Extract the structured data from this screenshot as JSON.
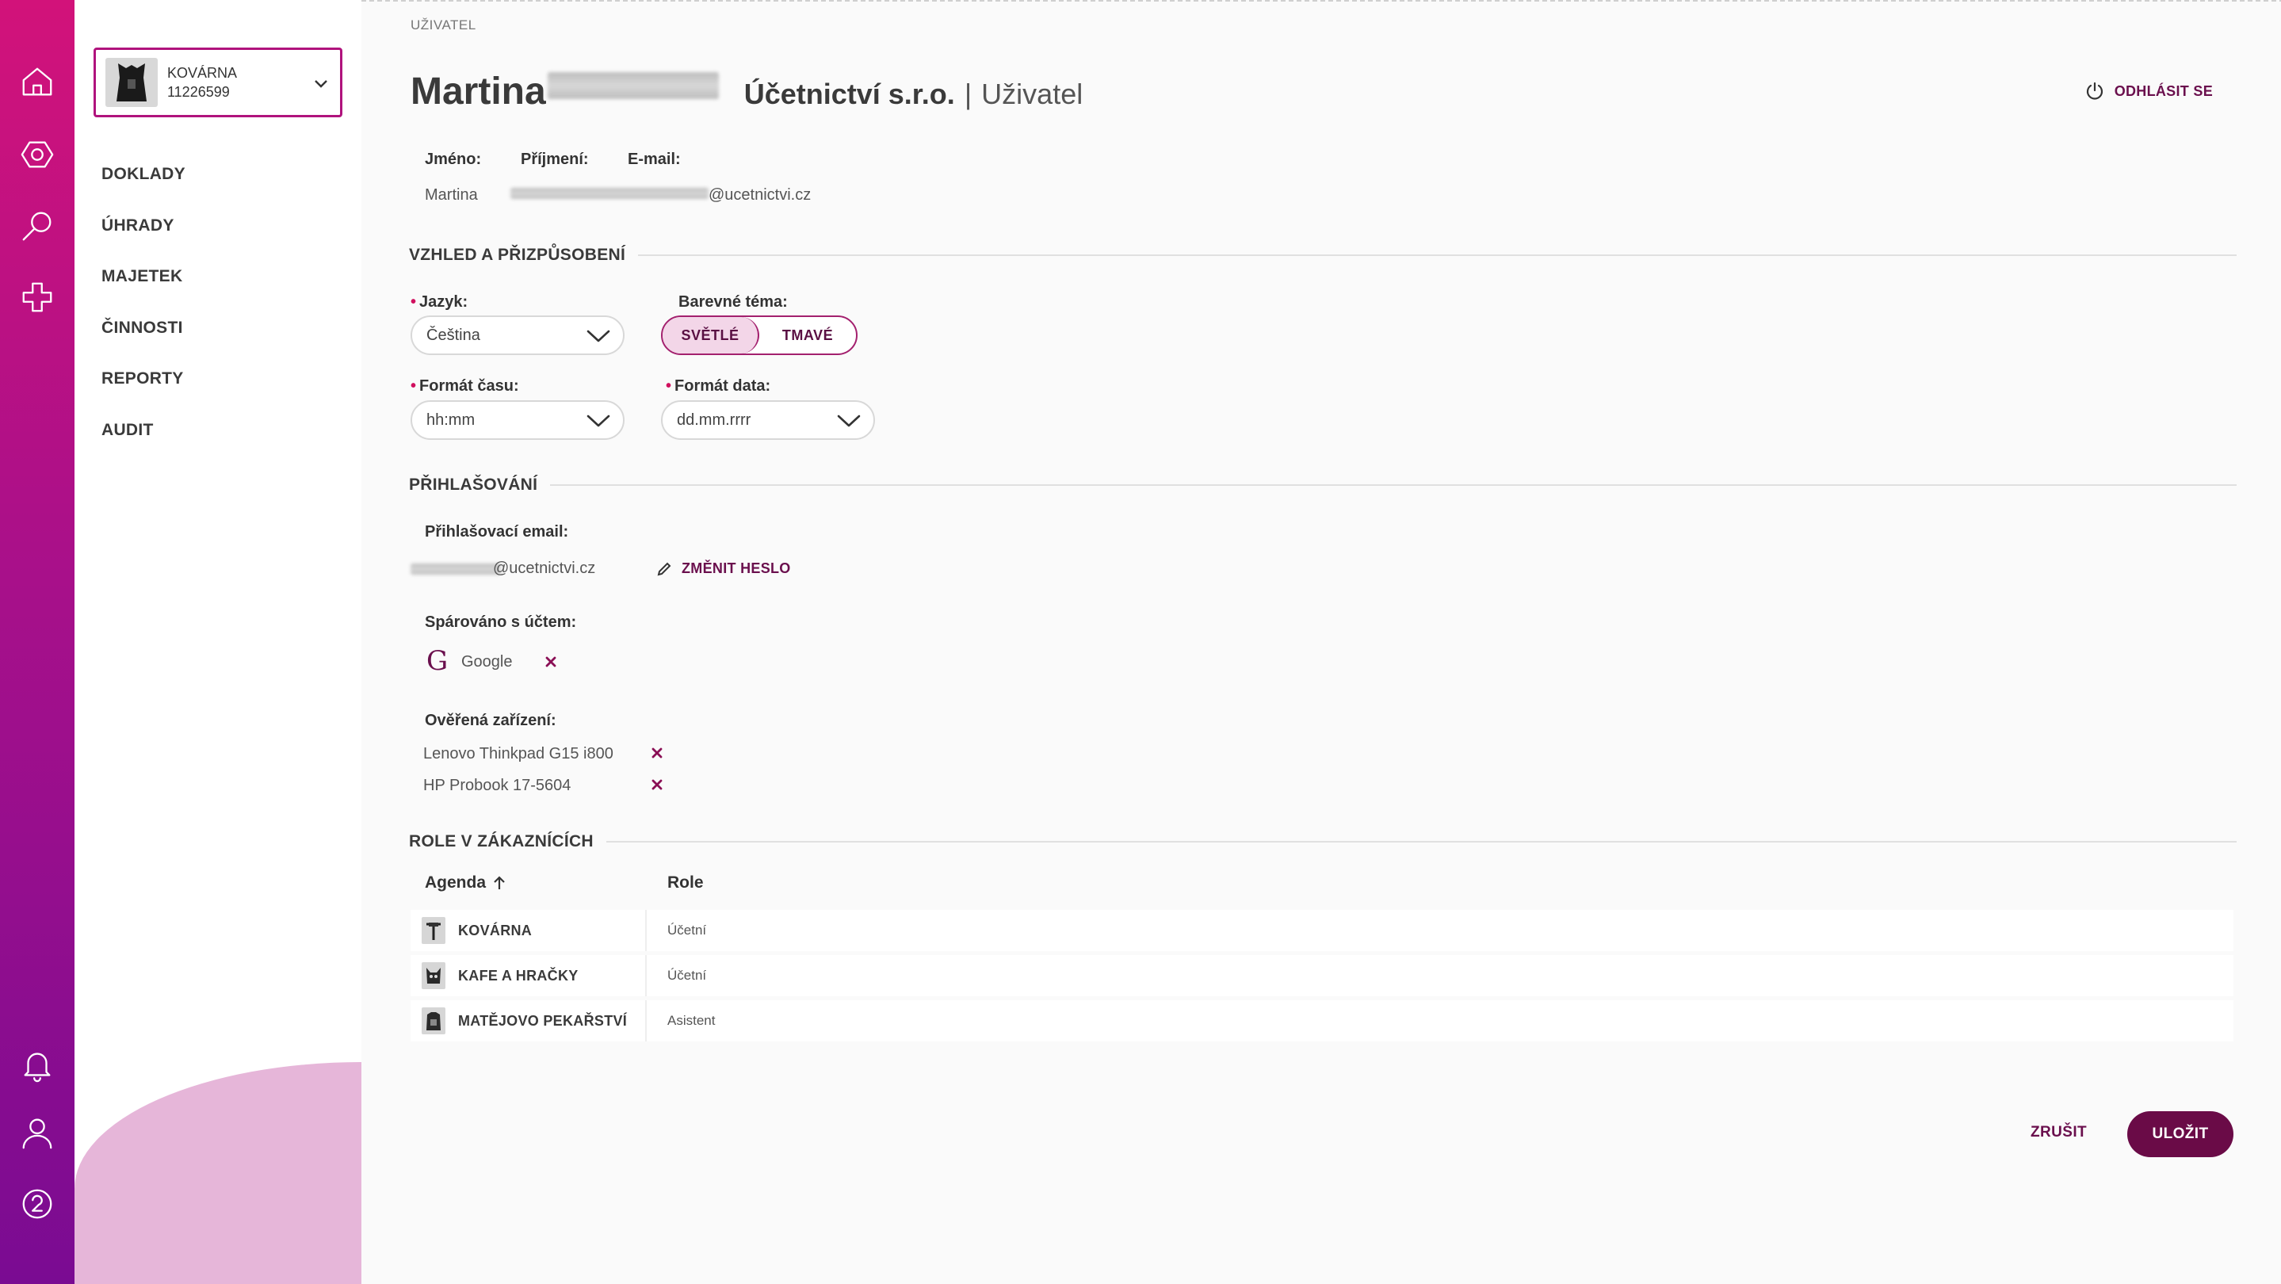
{
  "rail": {
    "icons": [
      "home-icon",
      "settings-hex-icon",
      "search-icon",
      "plus-cross-icon",
      "bell-icon",
      "user-icon",
      "help-icon"
    ]
  },
  "org": {
    "name": "KOVÁRNA",
    "id": "11226599"
  },
  "nav": {
    "items": [
      {
        "label": "DOKLADY"
      },
      {
        "label": "ÚHRADY"
      },
      {
        "label": "MAJETEK"
      },
      {
        "label": "ČINNOSTI"
      },
      {
        "label": "REPORTY"
      },
      {
        "label": "AUDIT"
      }
    ]
  },
  "page": {
    "breadcrumb": "UŽIVATEL",
    "title_first": "Martina",
    "company": "Účetnictví s.r.o.",
    "separator": "|",
    "role": "Uživatel",
    "logout_label": "ODHLÁSIT SE"
  },
  "user": {
    "first_name_label": "Jméno:",
    "last_name_label": "Příjmení:",
    "email_label": "E-mail:",
    "first_name": "Martina",
    "email_suffix": "@ucetnictvi.cz"
  },
  "appearance": {
    "title": "VZHLED A PŘIZPŮSOBENÍ",
    "language_label": "Jazyk:",
    "language_value": "Čeština",
    "theme_label": "Barevné téma:",
    "theme_light": "SVĚTLÉ",
    "theme_dark": "TMAVÉ",
    "time_format_label": "Formát času:",
    "time_format_value": "hh:mm",
    "date_format_label": "Formát data:",
    "date_format_value": "dd.mm.rrrr"
  },
  "login": {
    "title": "PŘIHLAŠOVÁNÍ",
    "email_label": "Přihlašovací email:",
    "email_suffix": "@ucetnictvi.cz",
    "change_password": "ZMĚNIT HESLO",
    "paired_label": "Spárováno s účtem:",
    "paired_account": "Google",
    "devices_label": "Ověřená zařízení:",
    "devices": [
      {
        "name": "Lenovo Thinkpad G15 i800"
      },
      {
        "name": "HP Probook 17-5604"
      }
    ]
  },
  "roles": {
    "title": "ROLE V ZÁKAZNÍCÍCH",
    "col_agenda": "Agenda",
    "col_role": "Role",
    "rows": [
      {
        "agenda": "KOVÁRNA",
        "role": "Účetní"
      },
      {
        "agenda": "KAFE A HRAČKY",
        "role": "Účetní"
      },
      {
        "agenda": "MATĚJOVO PEKAŘSTVÍ",
        "role": "Asistent"
      }
    ]
  },
  "actions": {
    "cancel": "ZRUŠIT",
    "save": "ULOŽIT"
  },
  "colors": {
    "accent": "#6a0b47",
    "rail_top": "#d2127a",
    "rail_bottom": "#7a0b92",
    "toggle_active": "#f3d6e8"
  }
}
